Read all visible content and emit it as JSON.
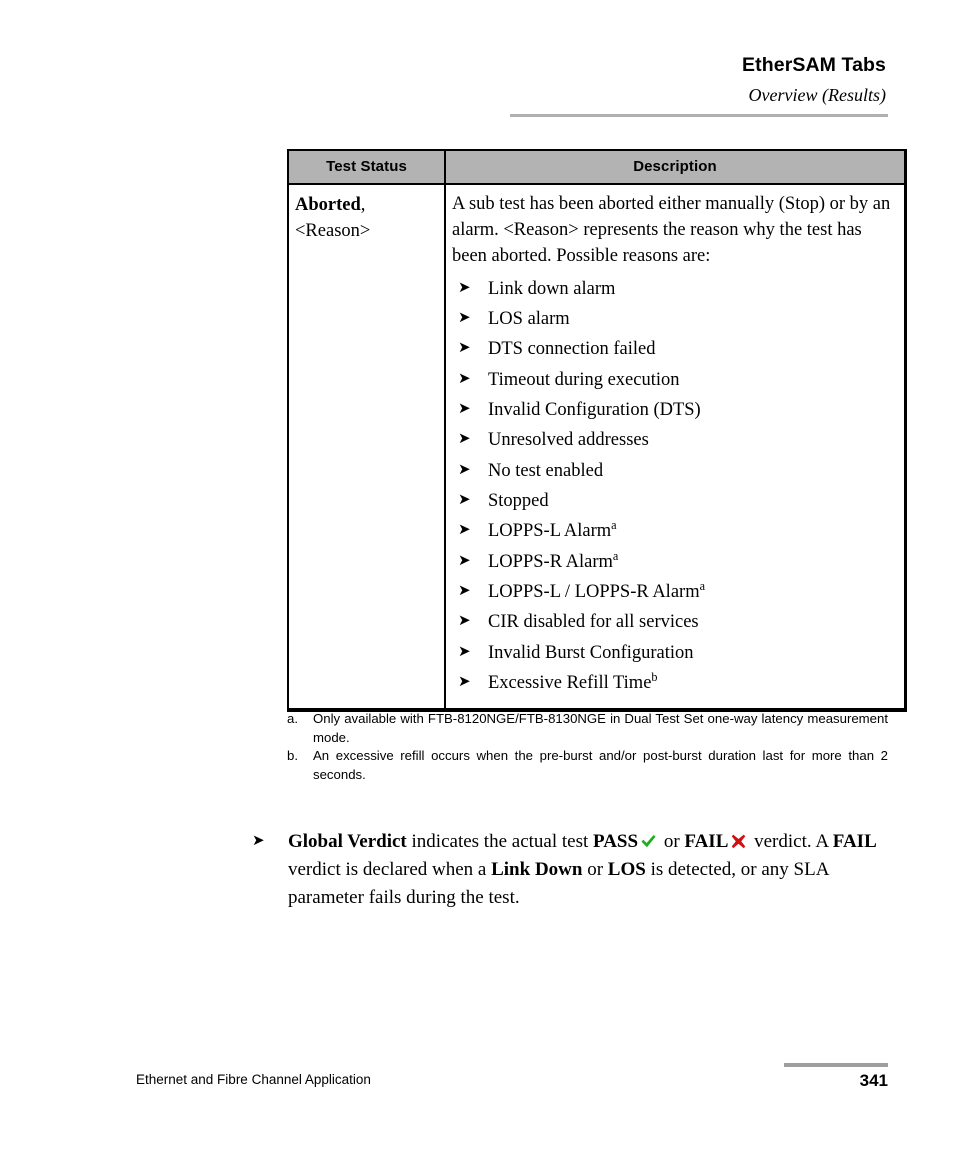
{
  "header": {
    "title": "EtherSAM Tabs",
    "subtitle": "Overview (Results)"
  },
  "table": {
    "columns": [
      "Test Status",
      "Description"
    ],
    "row": {
      "status_name": "Aborted",
      "status_suffix": ", <Reason>",
      "description_intro": "A sub test has been aborted either manually (Stop) or by an alarm. <Reason> represents the reason why the test has been aborted. Possible reasons are:",
      "reasons": [
        {
          "text": "Link down alarm",
          "note": ""
        },
        {
          "text": "LOS alarm",
          "note": ""
        },
        {
          "text": "DTS connection failed",
          "note": ""
        },
        {
          "text": "Timeout during execution",
          "note": ""
        },
        {
          "text": "Invalid Configuration (DTS)",
          "note": ""
        },
        {
          "text": "Unresolved addresses",
          "note": ""
        },
        {
          "text": "No test enabled",
          "note": ""
        },
        {
          "text": "Stopped",
          "note": ""
        },
        {
          "text": "LOPPS-L Alarm",
          "note": "a"
        },
        {
          "text": "LOPPS-R Alarm",
          "note": "a"
        },
        {
          "text": "LOPPS-L / LOPPS-R Alarm",
          "note": "a"
        },
        {
          "text": "CIR disabled for all services",
          "note": ""
        },
        {
          "text": "Invalid Burst Configuration",
          "note": ""
        },
        {
          "text": "Excessive Refill Time",
          "note": "b"
        }
      ]
    }
  },
  "footnotes": [
    {
      "marker": "a.",
      "text": "Only available with FTB-8120NGE/FTB-8130NGE in Dual Test Set one-way latency measurement mode."
    },
    {
      "marker": "b.",
      "text": "An excessive refill occurs when the pre-burst and/or post-burst duration last for more than 2 seconds."
    }
  ],
  "verdict": {
    "bullet": "➤",
    "term": "Global Verdict",
    "part1": " indicates the actual test ",
    "pass_label": "PASS",
    "pass_icon": "check-mark-icon",
    "pass_color": "#1fae1f",
    "or_label": " or ",
    "fail_label": "FAIL",
    "fail_icon": "cross-mark-icon",
    "fail_color": "#d00f0f",
    "part2": " verdict. A ",
    "fail_label2": "FAIL",
    "part3": " verdict is declared when a ",
    "link_down_label": "Link Down",
    "part4": " or ",
    "los_label": "LOS",
    "part5": " is detected, or any SLA parameter fails during the test."
  },
  "footer": {
    "document_title": "Ethernet and Fibre Channel Application",
    "page_number": "341"
  },
  "icons": {
    "list_bullet": "➤"
  },
  "colors": {
    "table_header_bg": "#b3b3b3",
    "header_rule": "#b0b0b0",
    "footer_rule": "#9e9e9e",
    "text": "#000000"
  }
}
